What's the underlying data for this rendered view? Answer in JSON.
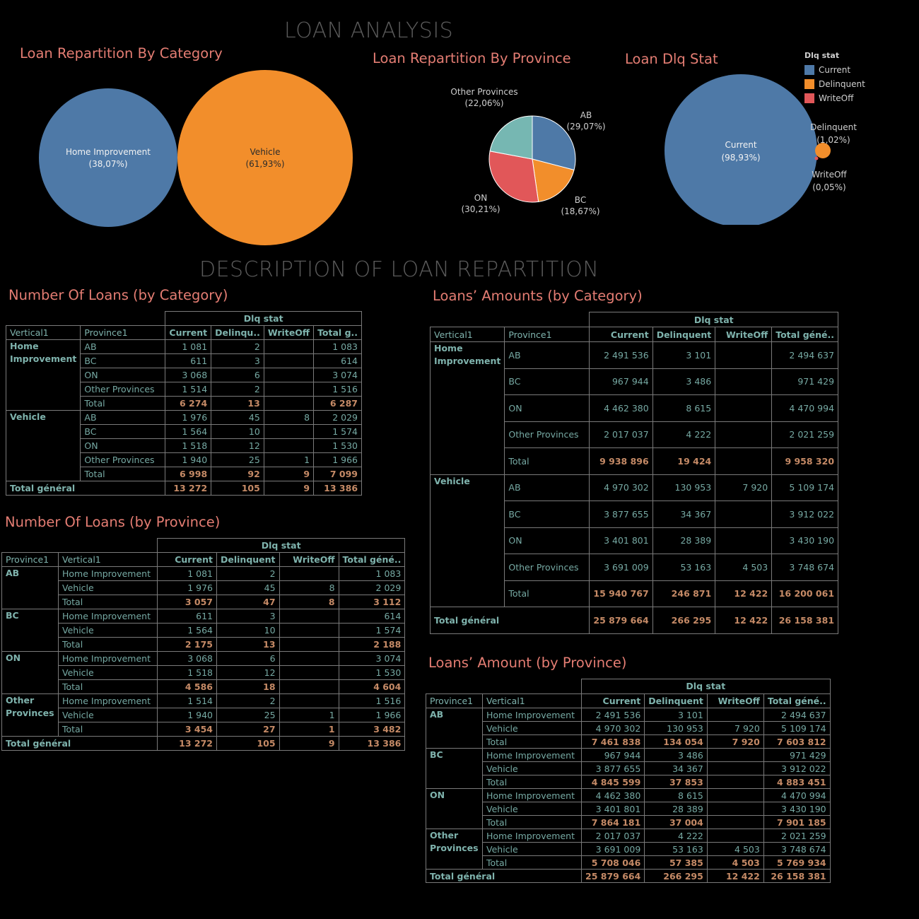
{
  "main_title": "LOAN ANALYSIS",
  "section_title": "DESCRIPTION OF LOAN REPARTITION",
  "colors": {
    "blue": "#4e79a7",
    "orange": "#f28e2b",
    "red": "#e15759",
    "teal": "#76b7b2",
    "title_accent": "#e47d73",
    "table_text": "#76a9a3",
    "table_total": "#c58a66"
  },
  "charts": {
    "category": {
      "title": "Loan Repartition By Category",
      "labels": [
        {
          "line1": "Home Improvement",
          "line2": "(38,07%)"
        },
        {
          "line1": "Vehicle",
          "line2": "(61,93%)"
        }
      ]
    },
    "province": {
      "title": "Loan Repartition By Province",
      "labels": [
        {
          "line1": "AB",
          "line2": "(29,07%)"
        },
        {
          "line1": "BC",
          "line2": "(18,67%)"
        },
        {
          "line1": "ON",
          "line2": "(30,21%)"
        },
        {
          "line1": "Other Provinces",
          "line2": "(22,06%)"
        }
      ]
    },
    "dlq": {
      "title": "Loan Dlq Stat",
      "labels": [
        {
          "line1": "Current",
          "line2": "(98,93%)"
        },
        {
          "line1": "Delinquent",
          "line2": "(1,02%)"
        },
        {
          "line1": "WriteOff",
          "line2": "(0,05%)"
        }
      ]
    }
  },
  "legend": {
    "title": "Dlq stat",
    "items": [
      {
        "label": "Current",
        "color": "#4e79a7"
      },
      {
        "label": "Delinquent",
        "color": "#f28e2b"
      },
      {
        "label": "WriteOff",
        "color": "#e15759"
      }
    ]
  },
  "chart_data": [
    {
      "type": "bubble",
      "title": "Loan Repartition By Category",
      "categories": [
        "Home Improvement",
        "Vehicle"
      ],
      "values": [
        38.07,
        61.93
      ],
      "unit": "%",
      "colors": [
        "#4e79a7",
        "#f28e2b"
      ]
    },
    {
      "type": "pie",
      "title": "Loan Repartition By Province",
      "categories": [
        "AB",
        "BC",
        "ON",
        "Other Provinces"
      ],
      "values": [
        29.07,
        18.67,
        30.21,
        22.06
      ],
      "unit": "%",
      "colors": [
        "#4e79a7",
        "#f28e2b",
        "#e15759",
        "#76b7b2"
      ]
    },
    {
      "type": "bubble",
      "title": "Loan Dlq Stat",
      "categories": [
        "Current",
        "Delinquent",
        "WriteOff"
      ],
      "values": [
        98.93,
        1.02,
        0.05
      ],
      "unit": "%",
      "colors": [
        "#4e79a7",
        "#f28e2b",
        "#e15759"
      ]
    }
  ],
  "tables": {
    "t1": {
      "title": "Number Of Loans (by Category)",
      "header_group": "Dlq stat",
      "dim_headers": [
        "Vertical1",
        "Province1"
      ],
      "col_headers": [
        "Current",
        "Delinqu..",
        "WriteOff",
        "Total g.."
      ],
      "groups": [
        {
          "name": "Home Improvement",
          "rows": [
            {
              "label": "AB",
              "values": [
                "1 081",
                "2",
                "",
                "1 083"
              ]
            },
            {
              "label": "BC",
              "values": [
                "611",
                "3",
                "",
                "614"
              ]
            },
            {
              "label": "ON",
              "values": [
                "3 068",
                "6",
                "",
                "3 074"
              ]
            },
            {
              "label": "Other Provinces",
              "values": [
                "1 514",
                "2",
                "",
                "1 516"
              ]
            },
            {
              "label": "Total",
              "total": true,
              "values": [
                "6 274",
                "13",
                "",
                "6 287"
              ]
            }
          ]
        },
        {
          "name": "Vehicle",
          "rows": [
            {
              "label": "AB",
              "values": [
                "1 976",
                "45",
                "8",
                "2 029"
              ]
            },
            {
              "label": "BC",
              "values": [
                "1 564",
                "10",
                "",
                "1 574"
              ]
            },
            {
              "label": "ON",
              "values": [
                "1 518",
                "12",
                "",
                "1 530"
              ]
            },
            {
              "label": "Other Provinces",
              "values": [
                "1 940",
                "25",
                "1",
                "1 966"
              ]
            },
            {
              "label": "Total",
              "total": true,
              "values": [
                "6 998",
                "92",
                "9",
                "7 099"
              ]
            }
          ]
        }
      ],
      "grand_total": {
        "label": "Total général",
        "values": [
          "13 272",
          "105",
          "9",
          "13 386"
        ]
      }
    },
    "t2": {
      "title": "Loans’ Amounts (by Category)",
      "header_group": "Dlq stat",
      "dim_headers": [
        "Vertical1",
        "Province1"
      ],
      "col_headers": [
        "Current",
        "Delinquent",
        "WriteOff",
        "Total géné.."
      ],
      "groups": [
        {
          "name": "Home Improvement",
          "rows": [
            {
              "label": "AB",
              "values": [
                "2 491 536",
                "3 101",
                "",
                "2 494 637"
              ]
            },
            {
              "label": "BC",
              "values": [
                "967 944",
                "3 486",
                "",
                "971 429"
              ]
            },
            {
              "label": "ON",
              "values": [
                "4 462 380",
                "8 615",
                "",
                "4 470 994"
              ]
            },
            {
              "label": "Other Provinces",
              "values": [
                "2 017 037",
                "4 222",
                "",
                "2 021 259"
              ]
            },
            {
              "label": "Total",
              "total": true,
              "values": [
                "9 938 896",
                "19 424",
                "",
                "9 958 320"
              ]
            }
          ]
        },
        {
          "name": "Vehicle",
          "rows": [
            {
              "label": "AB",
              "values": [
                "4 970 302",
                "130 953",
                "7 920",
                "5 109 174"
              ]
            },
            {
              "label": "BC",
              "values": [
                "3 877 655",
                "34 367",
                "",
                "3 912 022"
              ]
            },
            {
              "label": "ON",
              "values": [
                "3 401 801",
                "28 389",
                "",
                "3 430 190"
              ]
            },
            {
              "label": "Other Provinces",
              "values": [
                "3 691 009",
                "53 163",
                "4 503",
                "3 748 674"
              ]
            },
            {
              "label": "Total",
              "total": true,
              "values": [
                "15 940 767",
                "246 871",
                "12 422",
                "16 200 061"
              ]
            }
          ]
        }
      ],
      "grand_total": {
        "label": "Total général",
        "values": [
          "25 879 664",
          "266 295",
          "12 422",
          "26 158 381"
        ]
      }
    },
    "t3": {
      "title": "Number Of Loans (by Province)",
      "header_group": "Dlq stat",
      "dim_headers": [
        "Province1",
        "Vertical1"
      ],
      "col_headers": [
        "Current",
        "Delinquent",
        "WriteOff",
        "Total géné.."
      ],
      "groups": [
        {
          "name": "AB",
          "rows": [
            {
              "label": "Home Improvement",
              "values": [
                "1 081",
                "2",
                "",
                "1 083"
              ]
            },
            {
              "label": "Vehicle",
              "values": [
                "1 976",
                "45",
                "8",
                "2 029"
              ]
            },
            {
              "label": "Total",
              "total": true,
              "values": [
                "3 057",
                "47",
                "8",
                "3 112"
              ]
            }
          ]
        },
        {
          "name": "BC",
          "rows": [
            {
              "label": "Home Improvement",
              "values": [
                "611",
                "3",
                "",
                "614"
              ]
            },
            {
              "label": "Vehicle",
              "values": [
                "1 564",
                "10",
                "",
                "1 574"
              ]
            },
            {
              "label": "Total",
              "total": true,
              "values": [
                "2 175",
                "13",
                "",
                "2 188"
              ]
            }
          ]
        },
        {
          "name": "ON",
          "rows": [
            {
              "label": "Home Improvement",
              "values": [
                "3 068",
                "6",
                "",
                "3 074"
              ]
            },
            {
              "label": "Vehicle",
              "values": [
                "1 518",
                "12",
                "",
                "1 530"
              ]
            },
            {
              "label": "Total",
              "total": true,
              "values": [
                "4 586",
                "18",
                "",
                "4 604"
              ]
            }
          ]
        },
        {
          "name": "Other Provinces",
          "rows": [
            {
              "label": "Home Improvement",
              "values": [
                "1 514",
                "2",
                "",
                "1 516"
              ]
            },
            {
              "label": "Vehicle",
              "values": [
                "1 940",
                "25",
                "1",
                "1 966"
              ]
            },
            {
              "label": "Total",
              "total": true,
              "values": [
                "3 454",
                "27",
                "1",
                "3 482"
              ]
            }
          ]
        }
      ],
      "grand_total": {
        "label": "Total général",
        "values": [
          "13 272",
          "105",
          "9",
          "13 386"
        ]
      }
    },
    "t4": {
      "title": "Loans’ Amount (by Province)",
      "header_group": "Dlq stat",
      "dim_headers": [
        "Province1",
        "Vertical1"
      ],
      "col_headers": [
        "Current",
        "Delinquent",
        "WriteOff",
        "Total géné.."
      ],
      "groups": [
        {
          "name": "AB",
          "rows": [
            {
              "label": "Home Improvement",
              "values": [
                "2 491 536",
                "3 101",
                "",
                "2 494 637"
              ]
            },
            {
              "label": "Vehicle",
              "values": [
                "4 970 302",
                "130 953",
                "7 920",
                "5 109 174"
              ]
            },
            {
              "label": "Total",
              "total": true,
              "values": [
                "7 461 838",
                "134 054",
                "7 920",
                "7 603 812"
              ]
            }
          ]
        },
        {
          "name": "BC",
          "rows": [
            {
              "label": "Home Improvement",
              "values": [
                "967 944",
                "3 486",
                "",
                "971 429"
              ]
            },
            {
              "label": "Vehicle",
              "values": [
                "3 877 655",
                "34 367",
                "",
                "3 912 022"
              ]
            },
            {
              "label": "Total",
              "total": true,
              "values": [
                "4 845 599",
                "37 853",
                "",
                "4 883 451"
              ]
            }
          ]
        },
        {
          "name": "ON",
          "rows": [
            {
              "label": "Home Improvement",
              "values": [
                "4 462 380",
                "8 615",
                "",
                "4 470 994"
              ]
            },
            {
              "label": "Vehicle",
              "values": [
                "3 401 801",
                "28 389",
                "",
                "3 430 190"
              ]
            },
            {
              "label": "Total",
              "total": true,
              "values": [
                "7 864 181",
                "37 004",
                "",
                "7 901 185"
              ]
            }
          ]
        },
        {
          "name": "Other Provinces",
          "rows": [
            {
              "label": "Home Improvement",
              "values": [
                "2 017 037",
                "4 222",
                "",
                "2 021 259"
              ]
            },
            {
              "label": "Vehicle",
              "values": [
                "3 691 009",
                "53 163",
                "4 503",
                "3 748 674"
              ]
            },
            {
              "label": "Total",
              "total": true,
              "values": [
                "5 708 046",
                "57 385",
                "4 503",
                "5 769 934"
              ]
            }
          ]
        }
      ],
      "grand_total": {
        "label": "Total général",
        "values": [
          "25 879 664",
          "266 295",
          "12 422",
          "26 158 381"
        ]
      }
    }
  }
}
